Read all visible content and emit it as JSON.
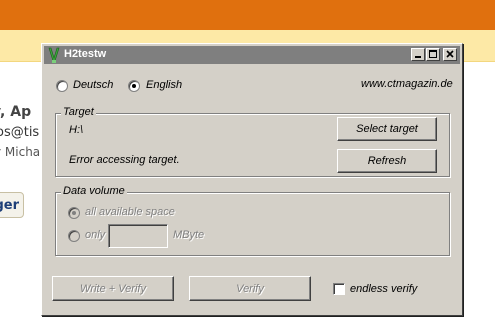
{
  "background": {
    "line1": "y, Ap",
    "line2": "os@tis",
    "line3": "y Micha",
    "button_label": "ger"
  },
  "window": {
    "title": "H2testw",
    "icons": [
      "h2testw-app-icon",
      "minimize-icon",
      "maximize-icon",
      "close-icon"
    ]
  },
  "language": {
    "options": [
      "Deutsch",
      "English"
    ],
    "selected": "English",
    "website": "www.ctmagazin.de"
  },
  "target": {
    "group_label": "Target",
    "path": "H:\\",
    "status": "Error accessing target.",
    "select_button": "Select target",
    "refresh_button": "Refresh"
  },
  "data_volume": {
    "group_label": "Data volume",
    "option_all": "all available space",
    "option_only": "only",
    "only_value": "",
    "unit": "MByte",
    "selected": "all available space",
    "enabled": false
  },
  "actions": {
    "write_verify": "Write + Verify",
    "verify": "Verify",
    "endless_verify": "endless verify",
    "endless_checked": false
  },
  "colors": {
    "window_bg": "#d4d0c8",
    "titlebar_inactive": "#7f7f7f",
    "browser_header": "#e0700e",
    "browser_subheader": "#fde9a6"
  }
}
